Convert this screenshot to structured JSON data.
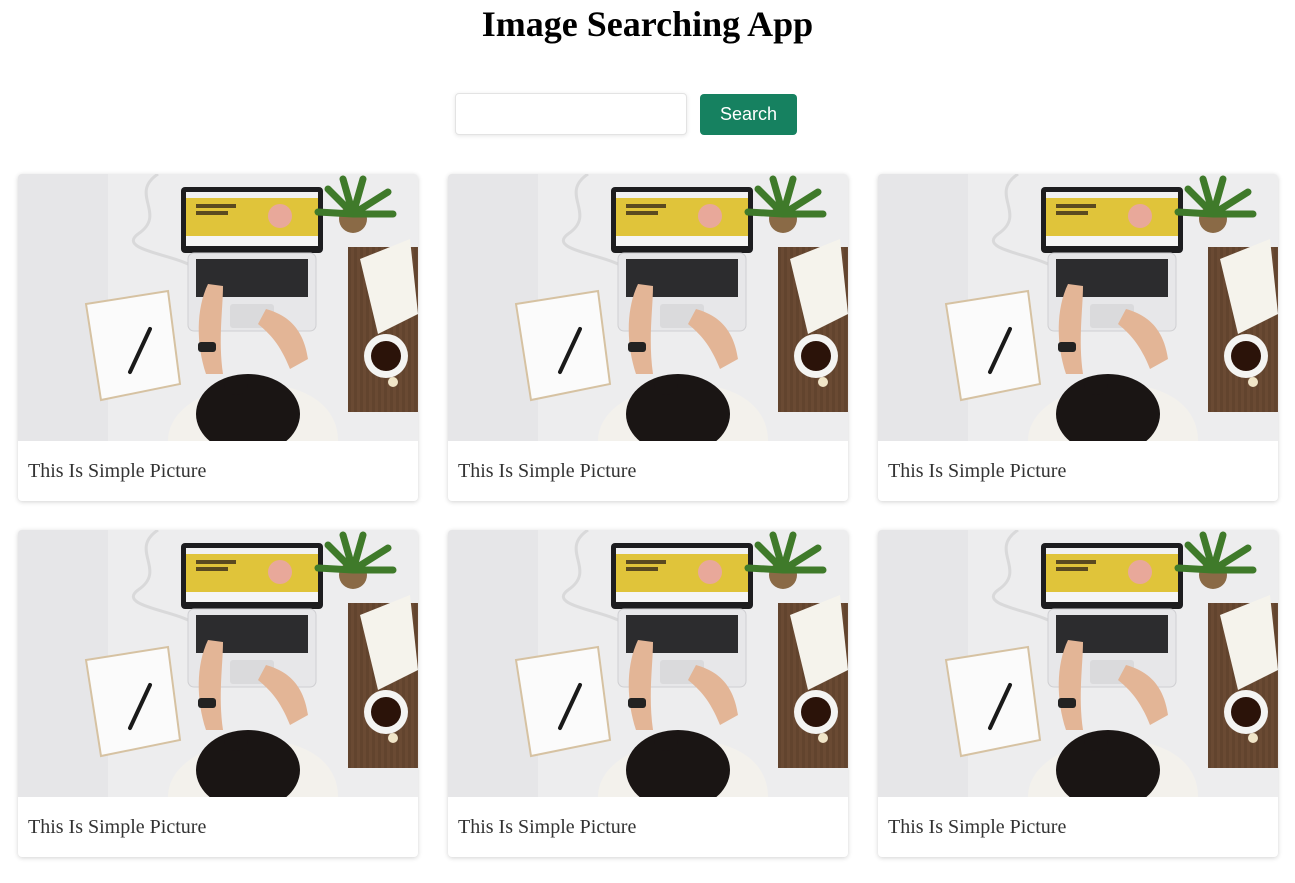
{
  "app": {
    "title": "Image Searching App"
  },
  "search": {
    "value": "",
    "placeholder": "",
    "button_label": "Search",
    "button_color": "#168160"
  },
  "cards": [
    {
      "caption": "This Is Simple Picture",
      "image": "laptop-desk-photo"
    },
    {
      "caption": "This Is Simple Picture",
      "image": "laptop-desk-photo"
    },
    {
      "caption": "This Is Simple Picture",
      "image": "laptop-desk-photo"
    },
    {
      "caption": "This Is Simple Picture",
      "image": "laptop-desk-photo"
    },
    {
      "caption": "This Is Simple Picture",
      "image": "laptop-desk-photo"
    },
    {
      "caption": "This Is Simple Picture",
      "image": "laptop-desk-photo"
    }
  ]
}
